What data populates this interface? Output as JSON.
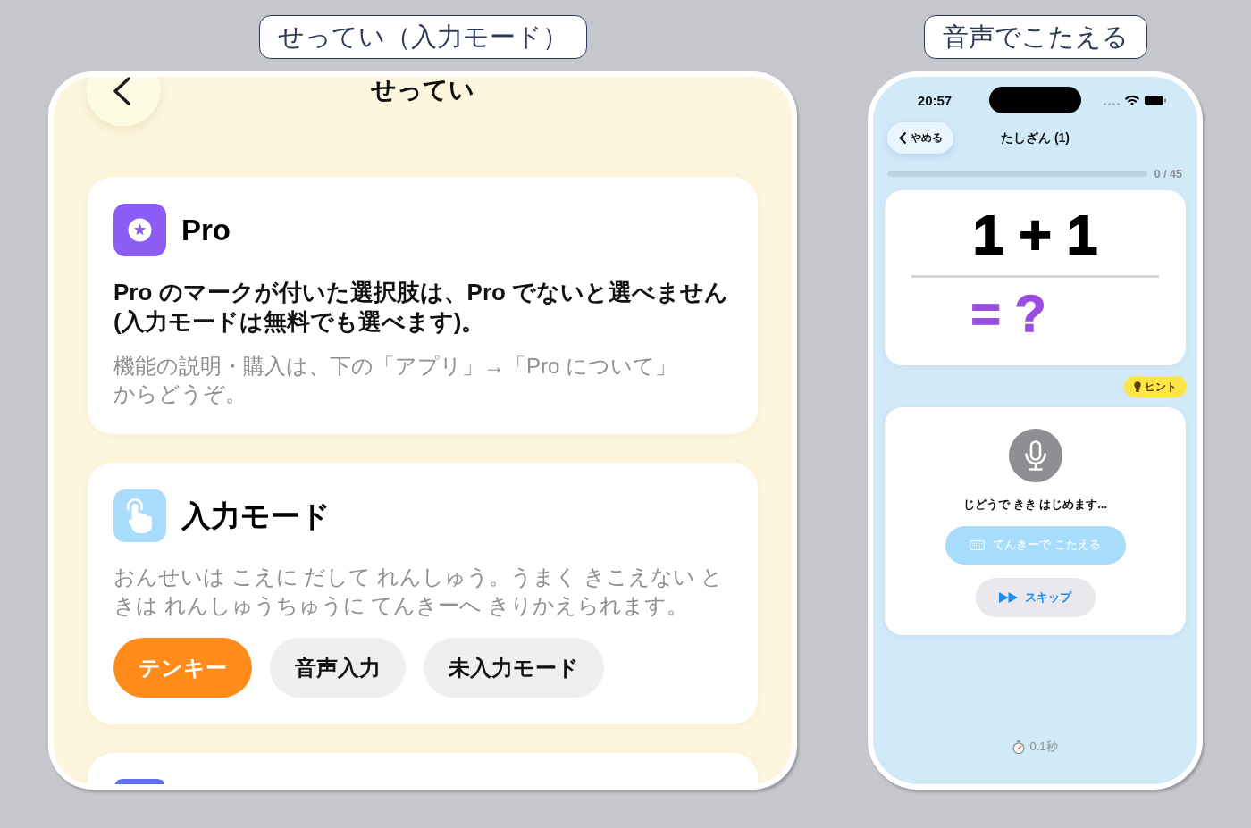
{
  "settings_screen": {
    "caption": "せってい（入力モード）",
    "title": "せってい",
    "cards": [
      {
        "kind": "pro",
        "title": "Pro",
        "body": "Pro のマークが付いた選択肢は、Pro でないと選べません(入力モードは無料でも選べます)。",
        "note": "機能の説明・購入は、下の「アプリ」→「Pro について」からどうぞ。"
      },
      {
        "kind": "input_mode",
        "title": "入力モード",
        "note": "おんせいは こえに だして れんしゅう。うまく きこえない ときは れんしゅうちゅうに てんきーへ きりかえられます。",
        "options": [
          {
            "label": "テンキー",
            "selected": true
          },
          {
            "label": "音声入力",
            "selected": false
          },
          {
            "label": "未入力モード",
            "selected": false
          }
        ]
      },
      {
        "kind": "clipped"
      }
    ]
  },
  "voice_screen": {
    "caption": "音声でこたえる",
    "status_bar": {
      "time": "20:57"
    },
    "nav": {
      "back_label": "やめる",
      "title": "たしざん (1)"
    },
    "progress": {
      "level": 0,
      "count": "0 / 45"
    },
    "question": {
      "expression": "1 + 1",
      "answer": "= ?"
    },
    "hint_button": {
      "label": "ヒント"
    },
    "voice_panel": {
      "status": "じどうで きき はじめます...",
      "keypad_button": {
        "label": "てんきーで こたえる",
        "disabled": true
      },
      "skip_button": {
        "label": "スキップ"
      }
    },
    "timer": "0.1秒"
  }
}
